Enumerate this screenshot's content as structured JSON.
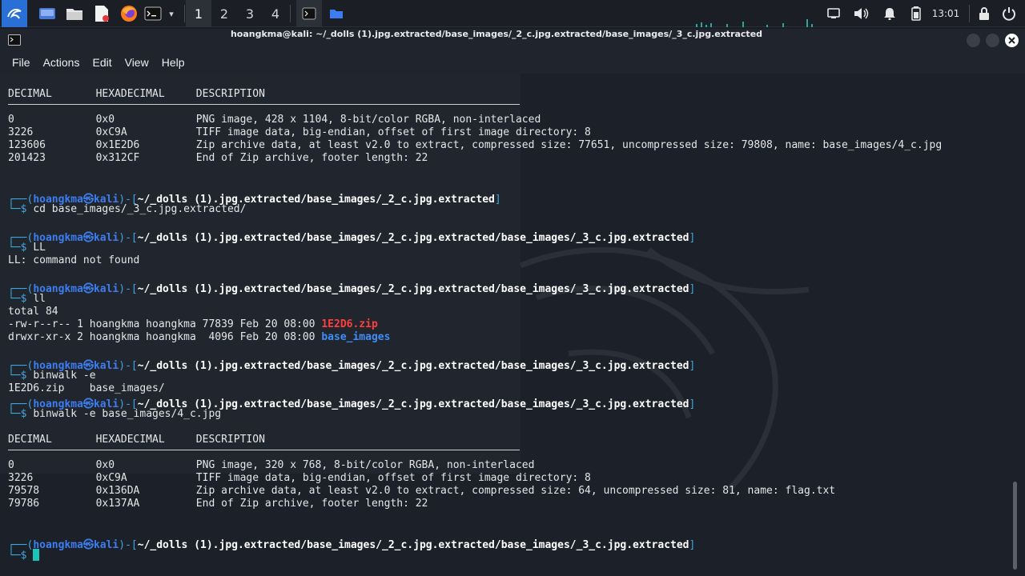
{
  "taskbar": {
    "workspaces": [
      "1",
      "2",
      "3",
      "4"
    ],
    "clock": "13:01"
  },
  "window": {
    "title": "hoangkma@kali: ~/_dolls (1).jpg.extracted/base_images/_2_c.jpg.extracted/base_images/_3_c.jpg.extracted"
  },
  "menu": {
    "file": "File",
    "actions": "Actions",
    "edit": "Edit",
    "view": "View",
    "help": "Help"
  },
  "prompt": {
    "open": "┌──(",
    "user": "hoangkma",
    "at": "㉿",
    "host": "kali",
    "mid": ")-[",
    "close": "]",
    "dollar": "└─$ ",
    "path_a": "~/_dolls (1).jpg.extracted/base_images/_2_c.jpg.extracted",
    "path_b": "~/_dolls (1).jpg.extracted/base_images/_2_c.jpg.extracted/base_images/_3_c.jpg.extracted"
  },
  "scan1": {
    "header": "DECIMAL       HEXADECIMAL     DESCRIPTION",
    "rows": [
      "0             0x0             PNG image, 428 x 1104, 8-bit/color RGBA, non-interlaced",
      "3226          0xC9A           TIFF image data, big-endian, offset of first image directory: 8",
      "123606        0x1E2D6         Zip archive data, at least v2.0 to extract, compressed size: 77651, uncompressed size: 79808, name: base_images/4_c.jpg",
      "201423        0x312CF         End of Zip archive, footer length: 22"
    ]
  },
  "commands": [
    "cd base_images/_3_c.jpg.extracted/",
    "LL",
    "ll",
    "binwalk -e",
    "binwalk -e base_images/4_c.jpg"
  ],
  "output": {
    "ll_error": "LL: command not found",
    "total": "total 84",
    "file1_meta": "-rw-r--r-- 1 hoangkma hoangkma 77839 Feb 20 08:00 ",
    "file1_name": "1E2D6.zip",
    "file2_meta": "drwxr-xr-x 2 hoangkma hoangkma  4096 Feb 20 08:00 ",
    "file2_name": "base_images",
    "binwalk_e": "1E2D6.zip    base_images/"
  },
  "scan2": {
    "header": "DECIMAL       HEXADECIMAL     DESCRIPTION",
    "rows": [
      "0             0x0             PNG image, 320 x 768, 8-bit/color RGBA, non-interlaced",
      "3226          0xC9A           TIFF image data, big-endian, offset of first image directory: 8",
      "79578         0x136DA         Zip archive data, at least v2.0 to extract, compressed size: 64, uncompressed size: 81, name: flag.txt",
      "79786         0x137AA         End of Zip archive, footer length: 22"
    ]
  },
  "colors": {
    "prompt_cyan": "#3fa7df",
    "prompt_blue": "#3d7df0",
    "zip_red": "#ff3f3f",
    "dir_blue": "#3f8df5",
    "cursor": "#1bc4b9"
  }
}
